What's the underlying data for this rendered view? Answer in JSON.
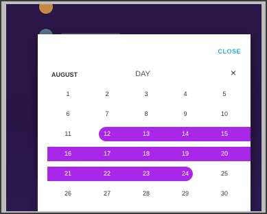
{
  "dialog": {
    "close_label": "CLOSE",
    "month": "AUGUST",
    "view": "DAY",
    "x_icon": "×",
    "accent_color": "#a928e8",
    "close_color": "#2ea8dc"
  },
  "calendar": {
    "weeks": [
      {
        "days": [
          "1",
          "2",
          "3",
          "4",
          "5"
        ]
      },
      {
        "days": [
          "6",
          "7",
          "8",
          "9",
          "10"
        ]
      },
      {
        "days": [
          "11",
          "12",
          "13",
          "14",
          "15"
        ]
      },
      {
        "days": [
          "16",
          "17",
          "18",
          "19",
          "20"
        ]
      },
      {
        "days": [
          "21",
          "22",
          "23",
          "24",
          "25"
        ]
      },
      {
        "days": [
          "26",
          "27",
          "28",
          "29",
          "30"
        ]
      }
    ],
    "selected_start": "12",
    "selected_end": "24"
  }
}
